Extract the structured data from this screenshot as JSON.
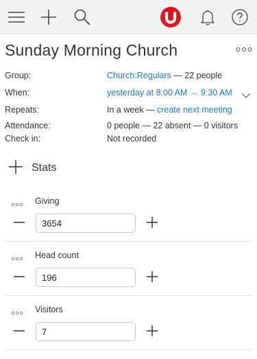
{
  "topbar": {
    "menu_icon": "hamburger-icon",
    "add_icon": "plus-icon",
    "search_icon": "search-icon",
    "logo_icon": "brand-logo-icon",
    "notifications_icon": "bell-icon",
    "help_icon": "help-icon",
    "brand_color": "#e0141f"
  },
  "header": {
    "title": "Sunday Morning Church",
    "more_icon": "ellipsis-icon"
  },
  "details": {
    "group_label": "Group:",
    "group_link": "Church:Regulars",
    "group_suffix": " — 22 people",
    "when_label": "When:",
    "when_link": "yesterday at 8:00 AM → 9:30 AM",
    "repeats_label": "Repeats:",
    "repeats_text": "In a week — ",
    "repeats_link": "create next meeting",
    "attendance_label": "Attendance:",
    "attendance_text": "0 people — 22 absent — 0 visitors",
    "checkin_label": "Check in:",
    "checkin_text": "Not recorded"
  },
  "stats": {
    "label": "Stats",
    "items": [
      {
        "name": "Giving",
        "value": "3654"
      },
      {
        "name": "Head count",
        "value": "196"
      },
      {
        "name": "Visitors",
        "value": "7"
      }
    ]
  },
  "colors": {
    "link": "#1b78c8",
    "topbar_bg": "#f2f2f2"
  }
}
